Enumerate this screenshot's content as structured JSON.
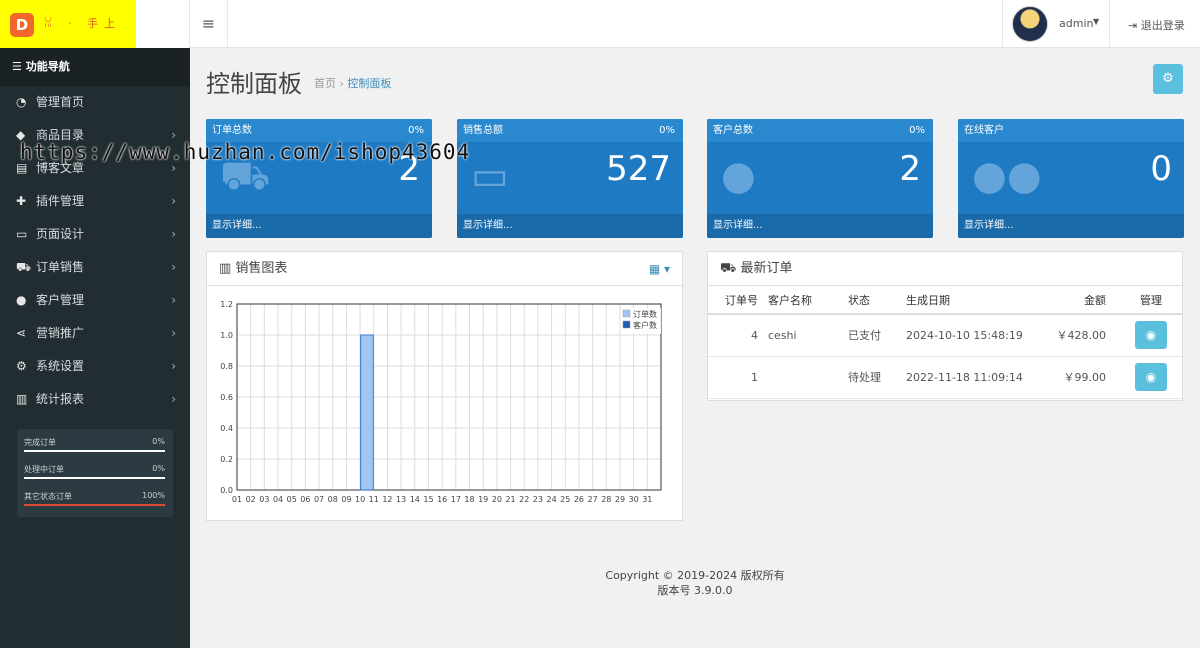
{
  "header": {
    "logo_letter": "D",
    "logo_text": "ꈍ · 手上",
    "menu_icon": "hamburger-icon",
    "user_name": "admin",
    "logout_label": "退出登录"
  },
  "sidebar": {
    "title": "功能导航",
    "items": [
      {
        "label": "管理首页",
        "icon": "dashboard-icon",
        "glyph": "◔",
        "arrow": false
      },
      {
        "label": "商品目录",
        "icon": "tag-icon",
        "glyph": "◆",
        "arrow": true
      },
      {
        "label": "博客文章",
        "icon": "newspaper-icon",
        "glyph": "▤",
        "arrow": true
      },
      {
        "label": "插件管理",
        "icon": "puzzle-icon",
        "glyph": "✚",
        "arrow": true
      },
      {
        "label": "页面设计",
        "icon": "desktop-icon",
        "glyph": "▭",
        "arrow": true
      },
      {
        "label": "订单销售",
        "icon": "cart-icon",
        "glyph": "⛟",
        "arrow": true
      },
      {
        "label": "客户管理",
        "icon": "user-icon",
        "glyph": "●",
        "arrow": true
      },
      {
        "label": "营销推广",
        "icon": "share-icon",
        "glyph": "⋖",
        "arrow": true
      },
      {
        "label": "系统设置",
        "icon": "gear-icon",
        "glyph": "⚙",
        "arrow": true
      },
      {
        "label": "统计报表",
        "icon": "bar-chart-icon",
        "glyph": "▥",
        "arrow": true
      }
    ],
    "stats": [
      {
        "label": "完成订单",
        "value": "0%"
      },
      {
        "label": "处理中订单",
        "value": "0%"
      },
      {
        "label": "其它状态订单",
        "value": "100%"
      }
    ]
  },
  "page": {
    "title": "控制面板",
    "breadcrumb_home": "首页",
    "breadcrumb_sep": "›",
    "breadcrumb_current": "控制面板"
  },
  "tiles": [
    {
      "title": "订单总数",
      "percent": "0%",
      "value": "2",
      "footer": "显示详细...",
      "icon": "cart-icon"
    },
    {
      "title": "销售总额",
      "percent": "0%",
      "value": "527",
      "footer": "显示详细...",
      "icon": "credit-card-icon"
    },
    {
      "title": "客户总数",
      "percent": "0%",
      "value": "2",
      "footer": "显示详细...",
      "icon": "user-icon"
    },
    {
      "title": "在线客户",
      "percent": "",
      "value": "0",
      "footer": "显示详细...",
      "icon": "users-icon"
    }
  ],
  "sales_panel": {
    "title": "销售图表",
    "icon": "bar-chart-icon",
    "tool_icon": "calendar-icon"
  },
  "orders_panel": {
    "title": "最新订单",
    "icon": "cart-icon",
    "columns": [
      "订单号",
      "客户名称",
      "状态",
      "生成日期",
      "金额",
      "管理"
    ],
    "rows": [
      {
        "id": "4",
        "customer": "ceshi",
        "status": "已支付",
        "date": "2024-10-10 15:48:19",
        "amount": "￥428.00"
      },
      {
        "id": "1",
        "customer": "",
        "status": "待处理",
        "date": "2022-11-18 11:09:14",
        "amount": "￥99.00"
      }
    ]
  },
  "chart_data": {
    "type": "bar",
    "categories": [
      "01",
      "02",
      "03",
      "04",
      "05",
      "06",
      "07",
      "08",
      "09",
      "10",
      "11",
      "12",
      "13",
      "14",
      "15",
      "16",
      "17",
      "18",
      "19",
      "20",
      "21",
      "22",
      "23",
      "24",
      "25",
      "26",
      "27",
      "28",
      "29",
      "30",
      "31"
    ],
    "series": [
      {
        "name": "订单数",
        "color": "#a3c6f0",
        "values": [
          0,
          0,
          0,
          0,
          0,
          0,
          0,
          0,
          0,
          1,
          0,
          0,
          0,
          0,
          0,
          0,
          0,
          0,
          0,
          0,
          0,
          0,
          0,
          0,
          0,
          0,
          0,
          0,
          0,
          0,
          0
        ]
      },
      {
        "name": "客户数",
        "color": "#1e5db7",
        "values": [
          0,
          0,
          0,
          0,
          0,
          0,
          0,
          0,
          0,
          0,
          0,
          0,
          0,
          0,
          0,
          0,
          0,
          0,
          0,
          0,
          0,
          0,
          0,
          0,
          0,
          0,
          0,
          0,
          0,
          0,
          0
        ]
      }
    ],
    "yticks": [
      "0.0",
      "0.2",
      "0.4",
      "0.6",
      "0.8",
      "1.0",
      "1.2"
    ],
    "ylim": [
      0,
      1.2
    ],
    "grid": true,
    "legend": "top-right"
  },
  "footer": {
    "copyright": "Copyright © 2019-2024 版权所有",
    "version": "版本号 3.9.0.0"
  },
  "watermark": "https://www.huzhan.com/ishop43604"
}
